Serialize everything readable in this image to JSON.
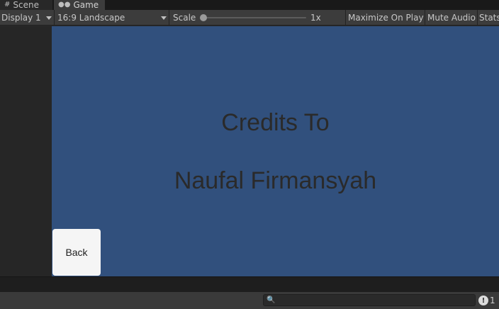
{
  "tabs": [
    {
      "label": "Scene",
      "icon": "grid-icon"
    },
    {
      "label": "Game",
      "icon": "gamepad-icon"
    }
  ],
  "toolbar": {
    "display": "Display 1",
    "aspect": "16:9 Landscape",
    "scale_label": "Scale",
    "scale_value": "1x",
    "scale_slider": 0.0,
    "maximize": "Maximize On Play",
    "mute": "Mute Audio",
    "stats": "Stats"
  },
  "game": {
    "title": "Credits To",
    "name": "Naufal Firmansyah",
    "back_button": "Back",
    "background_color": "#31507d"
  },
  "statusbar": {
    "search_placeholder": "",
    "message_count": "1"
  }
}
